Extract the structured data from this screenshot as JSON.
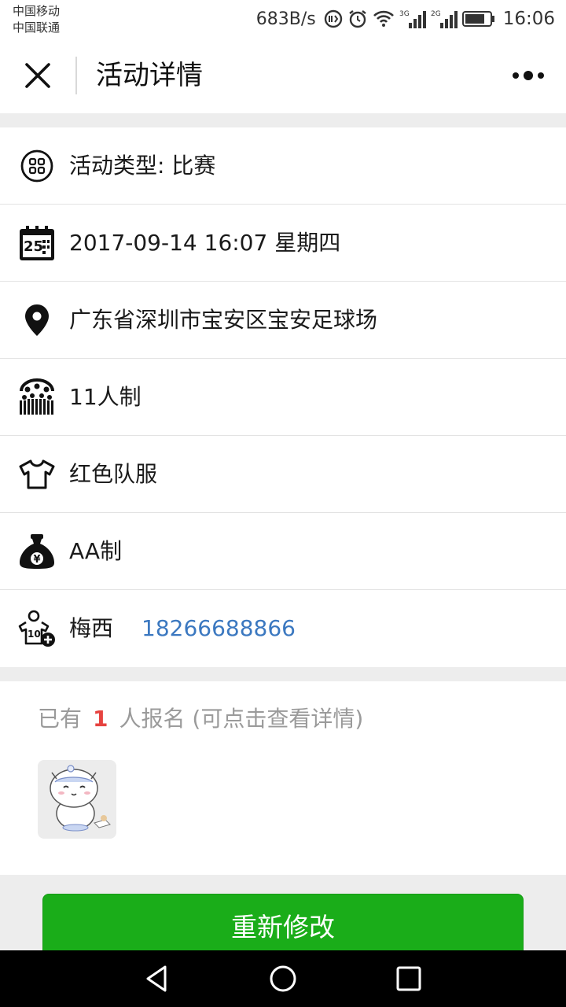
{
  "status_bar": {
    "carrier_1": "中国移动",
    "carrier_2": "中国联通",
    "net_speed": "683B/s",
    "signal_1_label": "3G",
    "signal_2_label": "2G",
    "time": "16:06"
  },
  "nav": {
    "title": "活动详情",
    "close_icon": "close-icon",
    "more_icon": "more-dots-icon"
  },
  "info": {
    "type": "活动类型: 比赛",
    "datetime": "2017-09-14 16:07 星期四",
    "location": "广东省深圳市宝安区宝安足球场",
    "format": "11人制",
    "uniform": "红色队服",
    "fee": "AA制",
    "organizer_name": "梅西",
    "organizer_phone": "18266688866",
    "calendar_day": "25",
    "jersey_number": "10",
    "currency_symbol": "¥"
  },
  "signup": {
    "prefix": "已有",
    "count": "1",
    "suffix": "人报名 (可点击查看详情)"
  },
  "actions": {
    "edit_label": "重新修改"
  },
  "colors": {
    "primary_green": "#1aad19",
    "phone_blue": "#3b78c0",
    "count_red": "#e64340"
  }
}
